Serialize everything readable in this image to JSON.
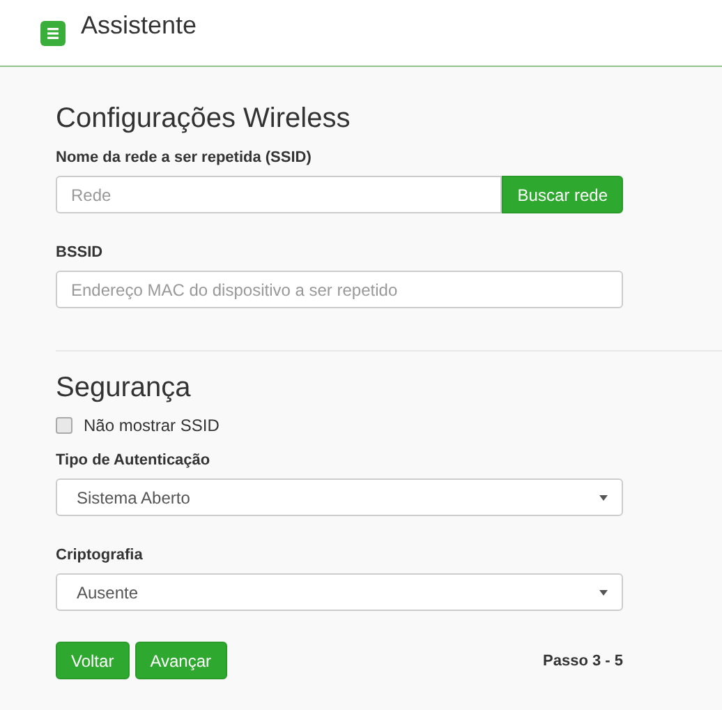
{
  "header": {
    "title": "Assistente"
  },
  "sections": [
    {
      "heading": "Configurações Wireless",
      "fields": [
        {
          "kind": "input_button",
          "label": "Nome da rede a ser repetida (SSID)",
          "placeholder": "Rede",
          "button": "Buscar rede"
        },
        {
          "kind": "input",
          "label": "BSSID",
          "placeholder": "Endereço MAC do dispositivo a ser repetido"
        }
      ]
    },
    {
      "heading": "Segurança",
      "fields": [
        {
          "kind": "checkbox",
          "label": "Não mostrar SSID",
          "checked": false
        },
        {
          "kind": "select",
          "label": "Tipo de Autenticação",
          "value": "Sistema Aberto"
        },
        {
          "kind": "select",
          "label": "Criptografia",
          "value": "Ausente"
        }
      ]
    }
  ],
  "buttons": [
    "Voltar",
    "Avançar"
  ],
  "step": "Passo 3 - 5"
}
